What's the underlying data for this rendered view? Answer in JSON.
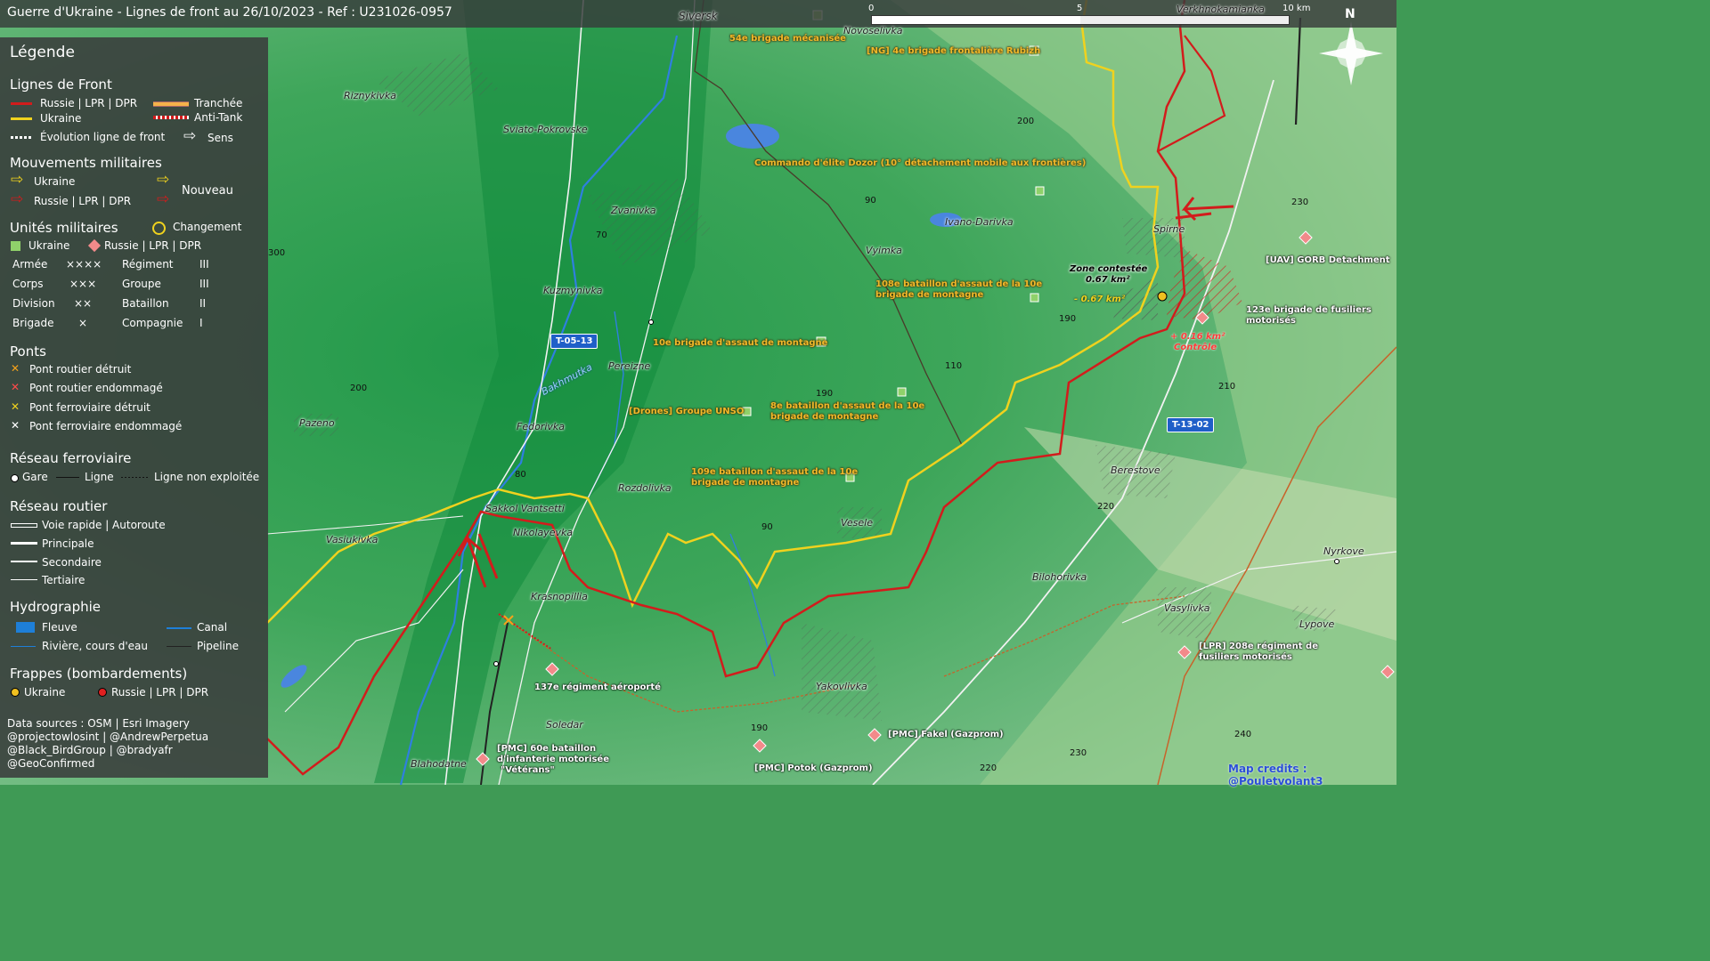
{
  "title": "Guerre d'Ukraine - Lignes de front au 26/10/2023 - Ref : U231026-0957",
  "scale": {
    "zero": "0",
    "mid": "5",
    "max": "10 km"
  },
  "north": "N",
  "legend": {
    "heading": "Légende",
    "front_lines": {
      "heading": "Lignes de Front",
      "russia": "Russie | LPR | DPR",
      "ukraine": "Ukraine",
      "trench": "Tranchée",
      "antitank": "Anti-Tank",
      "evolution": "Évolution ligne de front",
      "direction": "Sens"
    },
    "movements": {
      "heading": "Mouvements militaires",
      "ukraine": "Ukraine",
      "russia": "Russie | LPR | DPR",
      "new": "Nouveau"
    },
    "units": {
      "heading": "Unités militaires",
      "change": "Changement",
      "ukraine": "Ukraine",
      "russia": "Russie | LPR | DPR",
      "rows": [
        {
          "a": "Armée",
          "as": "××××",
          "b": "Régiment",
          "bs": "III"
        },
        {
          "a": "Corps",
          "as": "×××",
          "b": "Groupe",
          "bs": "III"
        },
        {
          "a": "Division",
          "as": "××",
          "b": "Bataillon",
          "bs": "II"
        },
        {
          "a": "Brigade",
          "as": "×",
          "b": "Compagnie",
          "bs": "I"
        }
      ]
    },
    "bridges": {
      "heading": "Ponts",
      "items": [
        "Pont routier détruit",
        "Pont routier endommagé",
        "Pont ferroviaire détruit",
        "Pont ferroviaire endommagé"
      ]
    },
    "rail": {
      "heading": "Réseau ferroviaire",
      "station": "Gare",
      "line": "Ligne",
      "unused": "Ligne non exploitée"
    },
    "roads": {
      "heading": "Réseau routier",
      "items": [
        "Voie rapide | Autoroute",
        "Principale",
        "Secondaire",
        "Tertiaire"
      ]
    },
    "hydro": {
      "heading": "Hydrographie",
      "river_major": "Fleuve",
      "canal": "Canal",
      "river": "Rivière, cours d'eau",
      "pipeline": "Pipeline"
    },
    "strikes": {
      "heading": "Frappes (bombardements)",
      "ukraine": "Ukraine",
      "russia": "Russie | LPR | DPR"
    },
    "sources": [
      "Data sources : OSM | Esri Imagery",
      "@projectowlosint | @AndrewPerpetua",
      "@Black_BirdGroup | @bradyafr",
      "@GeoConfirmed"
    ]
  },
  "colors": {
    "russia": "#d21c1c",
    "ukraine": "#f0d21e",
    "unit_ua": "#8fd16a",
    "unit_ru": "#f28a8a"
  },
  "towns": [
    "Siversk",
    "Novoselivka",
    "Verkhnokamianka",
    "Riznykivka",
    "Sviato-Pokrovske",
    "Zvanivka",
    "Ivano-Darivka",
    "Vyimka",
    "Spirne",
    "Kuzmynivka",
    "Pereizne",
    "Pazeno",
    "Fedorivka",
    "Rozdolivka",
    "Vesele",
    "Berestove",
    "Sakkol Vantsetti",
    "Nikolayevka",
    "Vasiukivka",
    "Krasnopillia",
    "Bilohorivka",
    "Vasylivka",
    "Lypove",
    "Nyrkove",
    "Yakovlivka",
    "Soledar",
    "Blahodatne",
    "Bakhmutka"
  ],
  "units_ua": [
    "54e brigade mécanisée",
    "[NG] 4e brigade frontalière Rubizh",
    "Commando d'élite Dozor (10° détachement mobile aux frontières)",
    "108e bataillon d'assaut de la 10e",
    "brigade de montagne",
    "10e brigade d'assaut de montagne",
    "[Drones] Groupe UNSO",
    "8e bataillon d'assaut de la 10e",
    "brigade de montagne",
    "109e bataillon d'assaut de la 10e",
    "brigade de montagne"
  ],
  "units_ru": [
    "[UAV] GORB Detachment",
    "123e brigade de fusiliers",
    "motorisés",
    "137e régiment aéroporté",
    "[LPR] 208e régiment de",
    "fusiliers motorisés",
    "[PMC] Fakel (Gazprom)",
    "[PMC] Potok (Gazprom)",
    "[PMC] 60e bataillon",
    "d'infanterie motorisée",
    "\"Vétérans\""
  ],
  "contested": {
    "zone": "Zone contestée",
    "area": "0.67 km²",
    "minus": "- 0.67 km²",
    "plus": "+ 0.16 km²",
    "control": "Contrôle"
  },
  "roads": [
    "T-05-13",
    "T-13-02"
  ],
  "elevations": [
    "200",
    "200",
    "190",
    "190",
    "190",
    "220",
    "230",
    "240",
    "230",
    "220",
    "210",
    "110",
    "90",
    "90",
    "80",
    "70",
    "300"
  ],
  "credit": "Map credits : @Pouletvolant3"
}
